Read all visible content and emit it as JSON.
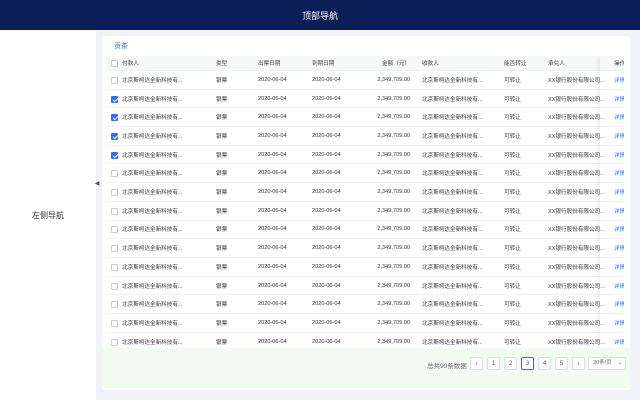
{
  "top_nav": {
    "title": "顶部导航"
  },
  "sidebar": {
    "title": "左侧导航",
    "collapse_icon": "chevron-left-icon",
    "collapse_glyph": "◀"
  },
  "tabs": [
    {
      "label": "贡茶"
    }
  ],
  "table": {
    "columns": [
      "付款人",
      "类型",
      "出票日期",
      "到期日期",
      "金额（元）",
      "收款人",
      "能否转让",
      "承兑人",
      "操作"
    ],
    "rows": [
      {
        "checked": false,
        "payer": "北京斯柯达全新科技有...",
        "type": "银票",
        "issue_date": "2020-06-04",
        "due_date": "2020-06-04",
        "amount": "2,349,709.00",
        "payee": "北京斯柯达全新科技有...",
        "transferable": "可转让",
        "acceptor": "XX银行股份有限公司...",
        "action": "详情"
      },
      {
        "checked": true,
        "payer": "北京斯柯达全新科技有...",
        "type": "银票",
        "issue_date": "2020-06-04",
        "due_date": "2020-06-04",
        "amount": "2,349,709.00",
        "payee": "北京斯柯达全新科技有...",
        "transferable": "可转让",
        "acceptor": "XX银行股份有限公司...",
        "action": "详情"
      },
      {
        "checked": true,
        "payer": "北京斯柯达全新科技有...",
        "type": "银票",
        "issue_date": "2020-06-04",
        "due_date": "2020-06-04",
        "amount": "2,349,709.00",
        "payee": "北京斯柯达全新科技有...",
        "transferable": "可转让",
        "acceptor": "XX银行股份有限公司...",
        "action": "详情"
      },
      {
        "checked": true,
        "payer": "北京斯柯达全新科技有...",
        "type": "银票",
        "issue_date": "2020-06-04",
        "due_date": "2020-06-04",
        "amount": "2,349,709.00",
        "payee": "北京斯柯达全新科技有...",
        "transferable": "可转让",
        "acceptor": "XX银行股份有限公司...",
        "action": "详情"
      },
      {
        "checked": true,
        "payer": "北京斯柯达全新科技有...",
        "type": "银票",
        "issue_date": "2020-06-04",
        "due_date": "2020-06-04",
        "amount": "2,349,709.00",
        "payee": "北京斯柯达全新科技有...",
        "transferable": "可转让",
        "acceptor": "XX银行股份有限公司...",
        "action": "详情"
      },
      {
        "checked": false,
        "payer": "北京斯柯达全新科技有...",
        "type": "银票",
        "issue_date": "2020-06-04",
        "due_date": "2020-06-04",
        "amount": "2,349,709.00",
        "payee": "北京斯柯达全新科技有...",
        "transferable": "可转让",
        "acceptor": "XX银行股份有限公司...",
        "action": "详情"
      },
      {
        "checked": false,
        "payer": "北京斯柯达全新科技有...",
        "type": "银票",
        "issue_date": "2020-06-04",
        "due_date": "2020-06-04",
        "amount": "2,349,709.00",
        "payee": "北京斯柯达全新科技有...",
        "transferable": "可转让",
        "acceptor": "XX银行股份有限公司...",
        "action": "详情"
      },
      {
        "checked": false,
        "payer": "北京斯柯达全新科技有...",
        "type": "银票",
        "issue_date": "2020-06-04",
        "due_date": "2020-06-04",
        "amount": "2,349,709.00",
        "payee": "北京斯柯达全新科技有...",
        "transferable": "可转让",
        "acceptor": "XX银行股份有限公司...",
        "action": "详情"
      },
      {
        "checked": false,
        "payer": "北京斯柯达全新科技有...",
        "type": "银票",
        "issue_date": "2020-06-04",
        "due_date": "2020-06-04",
        "amount": "2,349,709.00",
        "payee": "北京斯柯达全新科技有...",
        "transferable": "可转让",
        "acceptor": "XX银行股份有限公司...",
        "action": "详情"
      },
      {
        "checked": false,
        "payer": "北京斯柯达全新科技有...",
        "type": "银票",
        "issue_date": "2020-06-04",
        "due_date": "2020-06-04",
        "amount": "2,349,709.00",
        "payee": "北京斯柯达全新科技有...",
        "transferable": "可转让",
        "acceptor": "XX银行股份有限公司...",
        "action": "详情"
      },
      {
        "checked": false,
        "payer": "北京斯柯达全新科技有...",
        "type": "银票",
        "issue_date": "2020-06-04",
        "due_date": "2020-06-04",
        "amount": "2,349,709.00",
        "payee": "北京斯柯达全新科技有...",
        "transferable": "可转让",
        "acceptor": "XX银行股份有限公司...",
        "action": "详情"
      },
      {
        "checked": false,
        "payer": "北京斯柯达全新科技有...",
        "type": "银票",
        "issue_date": "2020-06-04",
        "due_date": "2020-06-04",
        "amount": "2,349,709.00",
        "payee": "北京斯柯达全新科技有...",
        "transferable": "可转让",
        "acceptor": "XX银行股份有限公司...",
        "action": "详情"
      },
      {
        "checked": false,
        "payer": "北京斯柯达全新科技有...",
        "type": "银票",
        "issue_date": "2020-06-04",
        "due_date": "2020-06-04",
        "amount": "2,349,709.00",
        "payee": "北京斯柯达全新科技有...",
        "transferable": "可转让",
        "acceptor": "XX银行股份有限公司...",
        "action": "详情"
      },
      {
        "checked": false,
        "payer": "北京斯柯达全新科技有...",
        "type": "银票",
        "issue_date": "2020-06-04",
        "due_date": "2020-06-04",
        "amount": "2,349,709.00",
        "payee": "北京斯柯达全新科技有...",
        "transferable": "可转让",
        "acceptor": "XX银行股份有限公司...",
        "action": "详情"
      },
      {
        "checked": false,
        "payer": "北京斯柯达全新科技有...",
        "type": "银票",
        "issue_date": "2020-06-04",
        "due_date": "2020-06-04",
        "amount": "2,349,709.00",
        "payee": "北京斯柯达全新科技有...",
        "transferable": "可转让",
        "acceptor": "XX银行股份有限公司...",
        "action": "详情"
      }
    ]
  },
  "pagination": {
    "total_text": "总共90条数据",
    "prev_glyph": "‹",
    "next_glyph": "›",
    "pages": [
      "1",
      "2",
      "3",
      "4",
      "5"
    ],
    "current_page": "3",
    "page_size": "30条/页",
    "page_size_glyph": "⌄"
  },
  "colors": {
    "topnav_bg": "#0b1e58",
    "accent": "#2f6bff",
    "footer_bg": "#f1fbf0"
  }
}
